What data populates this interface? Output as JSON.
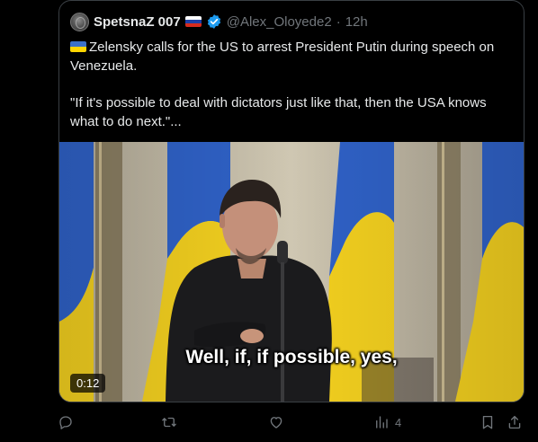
{
  "tweet": {
    "display_name": "SpetsnaZ 007",
    "handle": "@Alex_Oloyede2",
    "separator": "·",
    "time": "12h",
    "text_line1": "Zelensky calls for the US to arrest President Putin during speech on Venezuela.",
    "text_line2": "\"If it's possible to deal with dictators just like that, then the USA knows what to do next.\"..."
  },
  "media": {
    "duration": "0:12",
    "subtitle": "Well, if, if possible, yes,"
  },
  "actions": {
    "views_count": "4"
  },
  "icons": {
    "avatar": "avatar-image",
    "russia_flag": "russia-flag-icon",
    "ukraine_flag": "ukraine-flag-icon",
    "verified": "verified-badge-icon",
    "reply": "reply-icon",
    "repost": "repost-icon",
    "like": "like-icon",
    "views": "views-icon",
    "bookmark": "bookmark-icon",
    "share": "share-icon"
  },
  "colors": {
    "background": "#000000",
    "text": "#e7e9ea",
    "muted": "#71767b",
    "verified": "#1d9bf0",
    "ukraine_blue": "#3b70c9",
    "ukraine_yellow": "#ffd500"
  }
}
